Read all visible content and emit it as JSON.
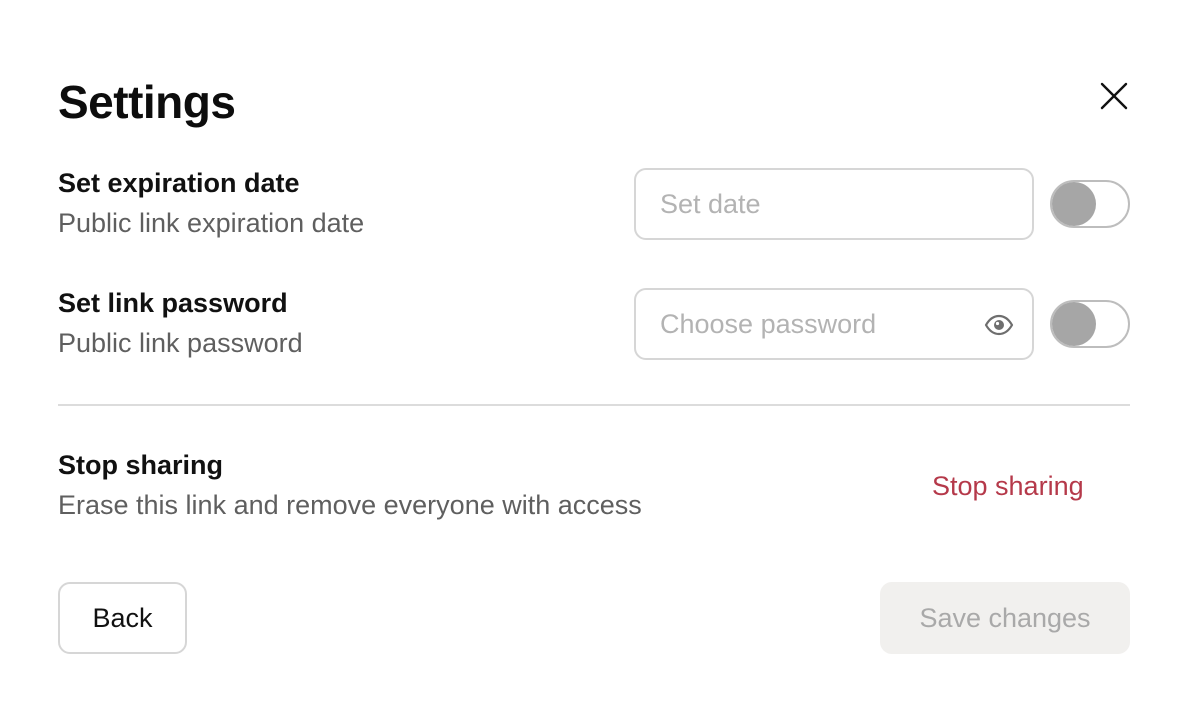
{
  "dialog": {
    "title": "Settings",
    "close_icon": "close-icon"
  },
  "expiration": {
    "title": "Set expiration date",
    "subtitle": "Public link expiration date",
    "input_placeholder": "Set date",
    "input_value": "",
    "toggle_on": false
  },
  "password": {
    "title": "Set link password",
    "subtitle": "Public link password",
    "input_placeholder": "Choose password",
    "input_value": "",
    "visibility_icon": "eye-icon",
    "toggle_on": false
  },
  "stop_sharing": {
    "title": "Stop sharing",
    "subtitle": "Erase this link and remove everyone with access",
    "action_label": "Stop sharing"
  },
  "footer": {
    "back_label": "Back",
    "save_label": "Save changes",
    "save_enabled": false
  },
  "colors": {
    "danger": "#b5394a",
    "toggle_knob_off": "#a6a6a6",
    "disabled_bg": "#f1f0ee",
    "disabled_text": "#a9a9a9"
  }
}
